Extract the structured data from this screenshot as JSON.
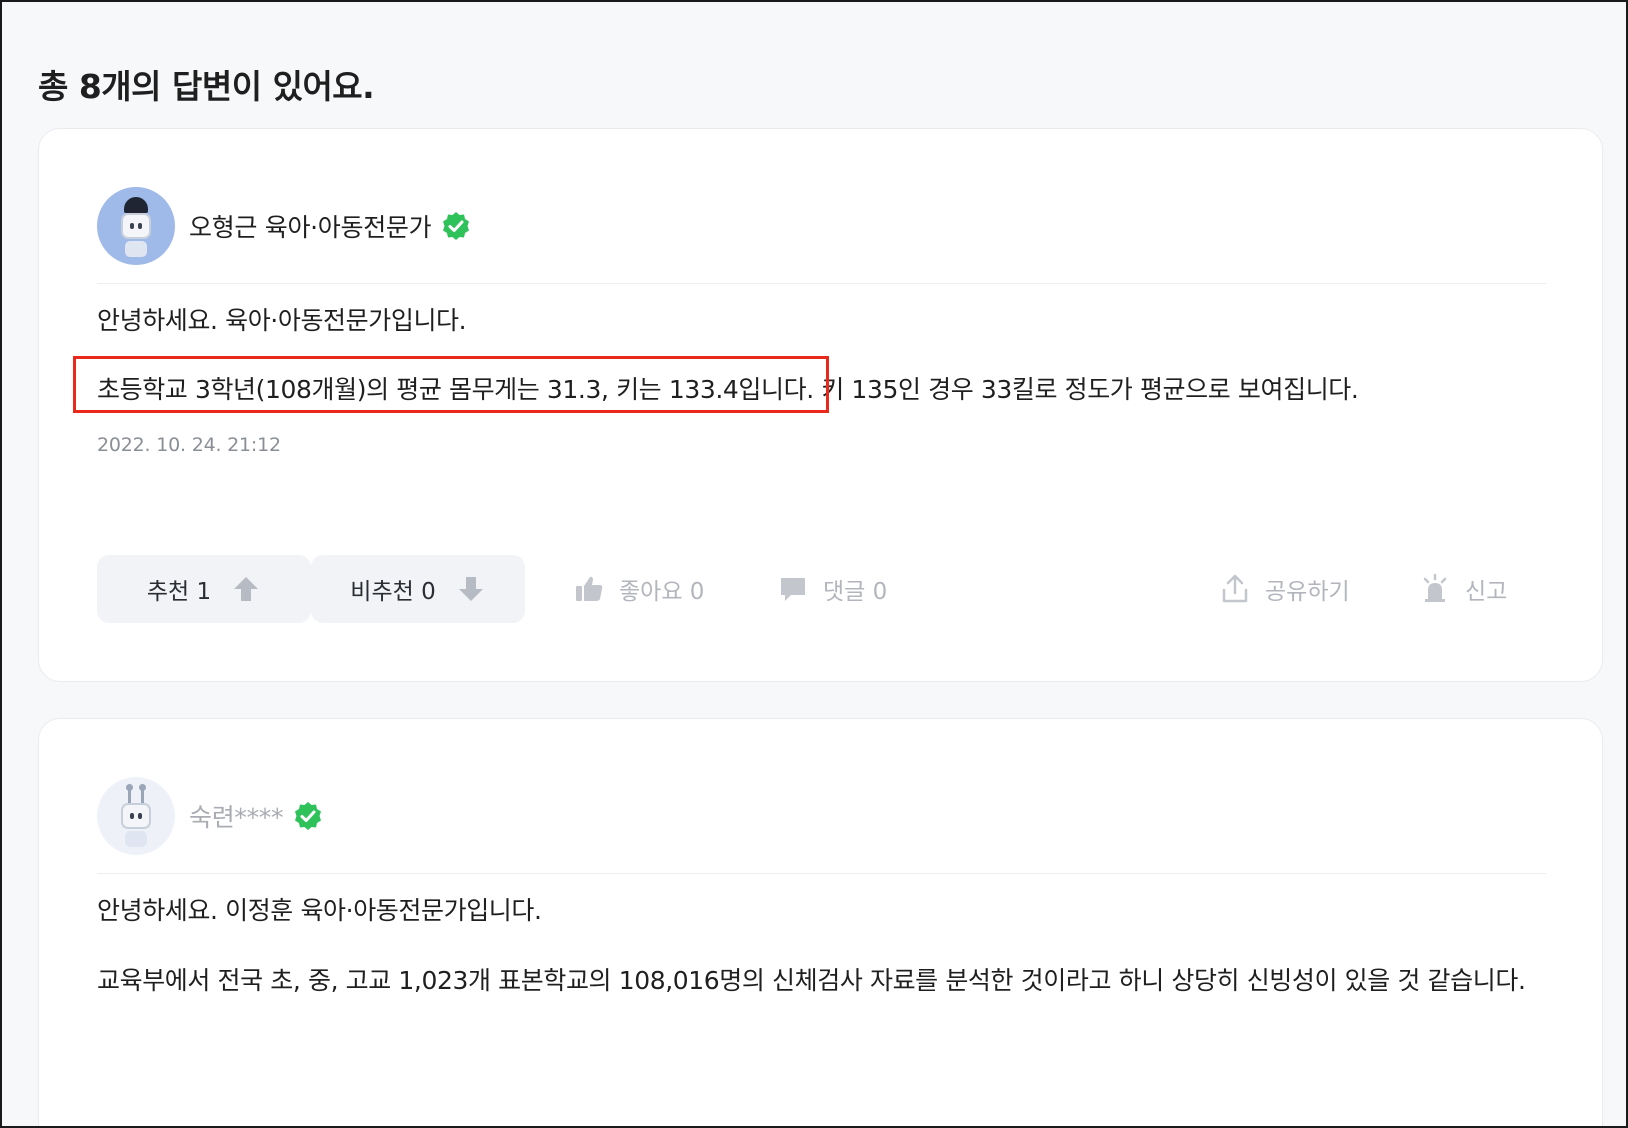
{
  "header": {
    "title": "총 8개의 답변이 있어요."
  },
  "answers": [
    {
      "author": "오형근 육아·아동전문가",
      "paragraphs": [
        "안녕하세요. 육아·아동전문가입니다.",
        "초등학교 3학년(108개월)의 평균 몸무게는 31.3, 키는 133.4입니다. 키 135인 경우 33킬로 정도가 평균으로 보여집니다."
      ],
      "timestamp": "2022. 10. 24. 21:12",
      "upvote_label": "추천 1",
      "downvote_label": "비추천 0",
      "like_label": "좋아요 0",
      "comment_label": "댓글 0",
      "share_label": "공유하기",
      "report_label": "신고"
    },
    {
      "author": "숙련****",
      "paragraphs": [
        "안녕하세요. 이정훈 육아·아동전문가입니다.",
        "교육부에서 전국 초, 중, 고교 1,023개 표본학교의 108,016명의 신체검사 자료를 분석한 것이라고 하니 상당히 신빙성이 있을 것 같습니다."
      ]
    }
  ],
  "icons": {
    "verified": "check-badge-icon",
    "upvote": "arrow-up-icon",
    "downvote": "arrow-down-icon",
    "like": "thumbs-up-icon",
    "comment": "speech-bubble-icon",
    "share": "share-icon",
    "report": "siren-icon"
  },
  "colors": {
    "highlight": "#e8291c",
    "verified": "#2fc25b",
    "muted": "#b2b6bc"
  }
}
